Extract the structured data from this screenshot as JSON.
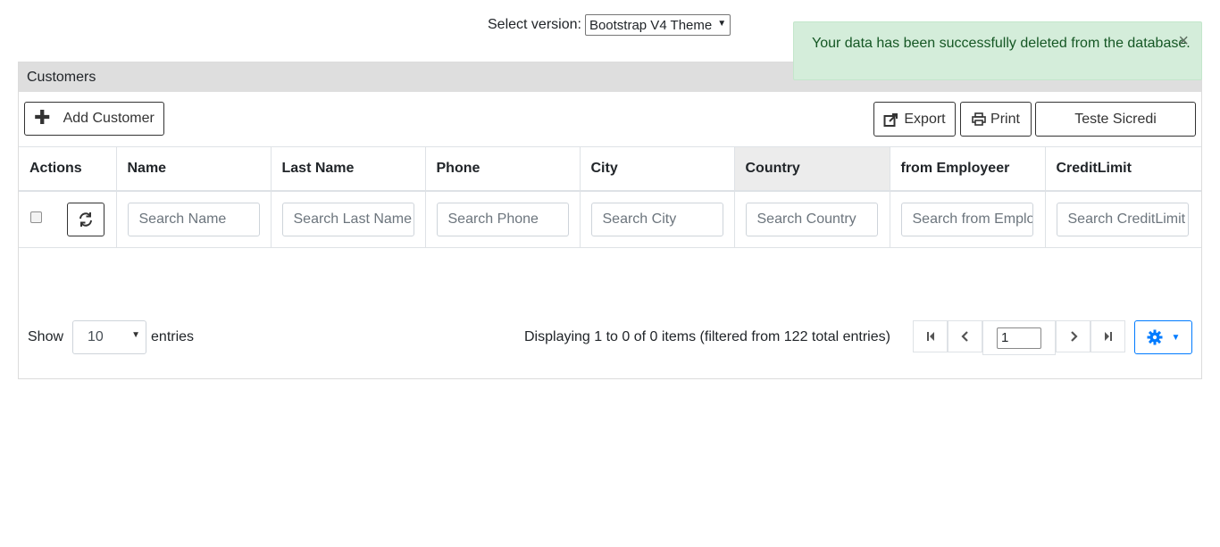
{
  "version": {
    "label": "Select version:",
    "selected": "Bootstrap V4 Theme"
  },
  "alert": {
    "message": "Your data has been successfully deleted from the database.",
    "close": "×"
  },
  "panel": {
    "title": "Customers"
  },
  "toolbar": {
    "add_label": "Add Customer",
    "export_label": "Export",
    "print_label": "Print",
    "custom_label": "Teste Sicredi"
  },
  "grid": {
    "columns": [
      "Actions",
      "Name",
      "Last Name",
      "Phone",
      "City",
      "Country",
      "from Employeer",
      "CreditLimit"
    ],
    "active_column": "Country",
    "search_placeholders": [
      "Search Name",
      "Search Last Name",
      "Search Phone",
      "Search City",
      "Search Country",
      "Search from Employeer",
      "Search CreditLimit"
    ]
  },
  "footer": {
    "show_label": "Show",
    "entries_value": "10",
    "entries_label": "entries",
    "info": "Displaying 1 to 0 of 0 items (filtered from 122 total entries)",
    "page_value": "1"
  },
  "colors": {
    "alert_bg": "#d4edda",
    "alert_text": "#155724",
    "primary": "#007bff",
    "header_bg": "#dedede"
  }
}
